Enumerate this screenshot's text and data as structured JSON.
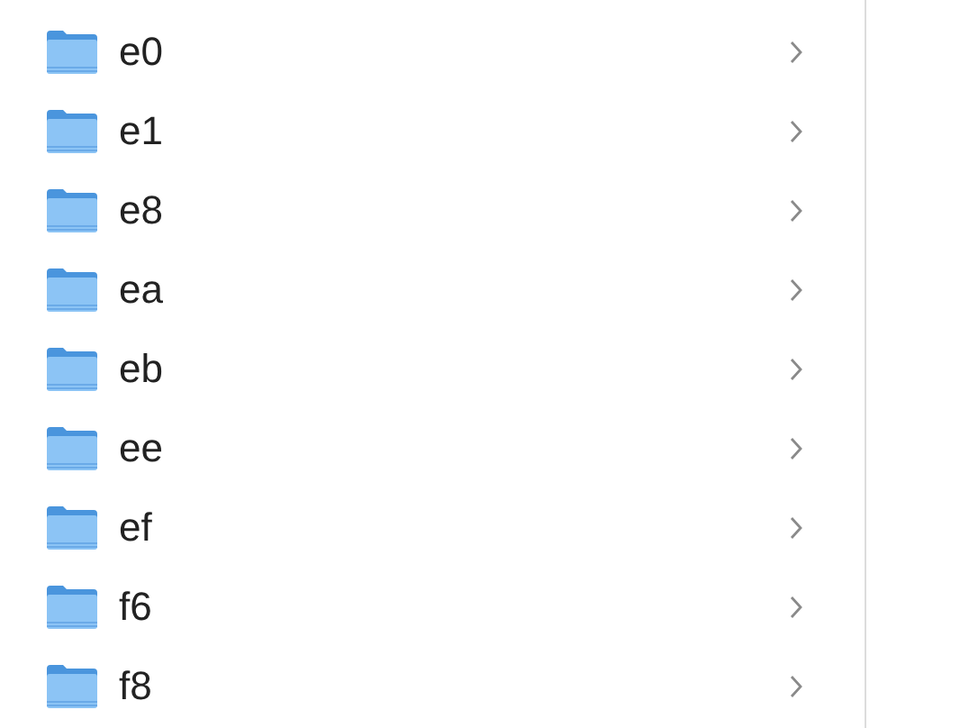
{
  "folders": [
    {
      "name": "e0"
    },
    {
      "name": "e1"
    },
    {
      "name": "e8"
    },
    {
      "name": "ea"
    },
    {
      "name": "eb"
    },
    {
      "name": "ee"
    },
    {
      "name": "ef"
    },
    {
      "name": "f6"
    },
    {
      "name": "f8"
    }
  ]
}
